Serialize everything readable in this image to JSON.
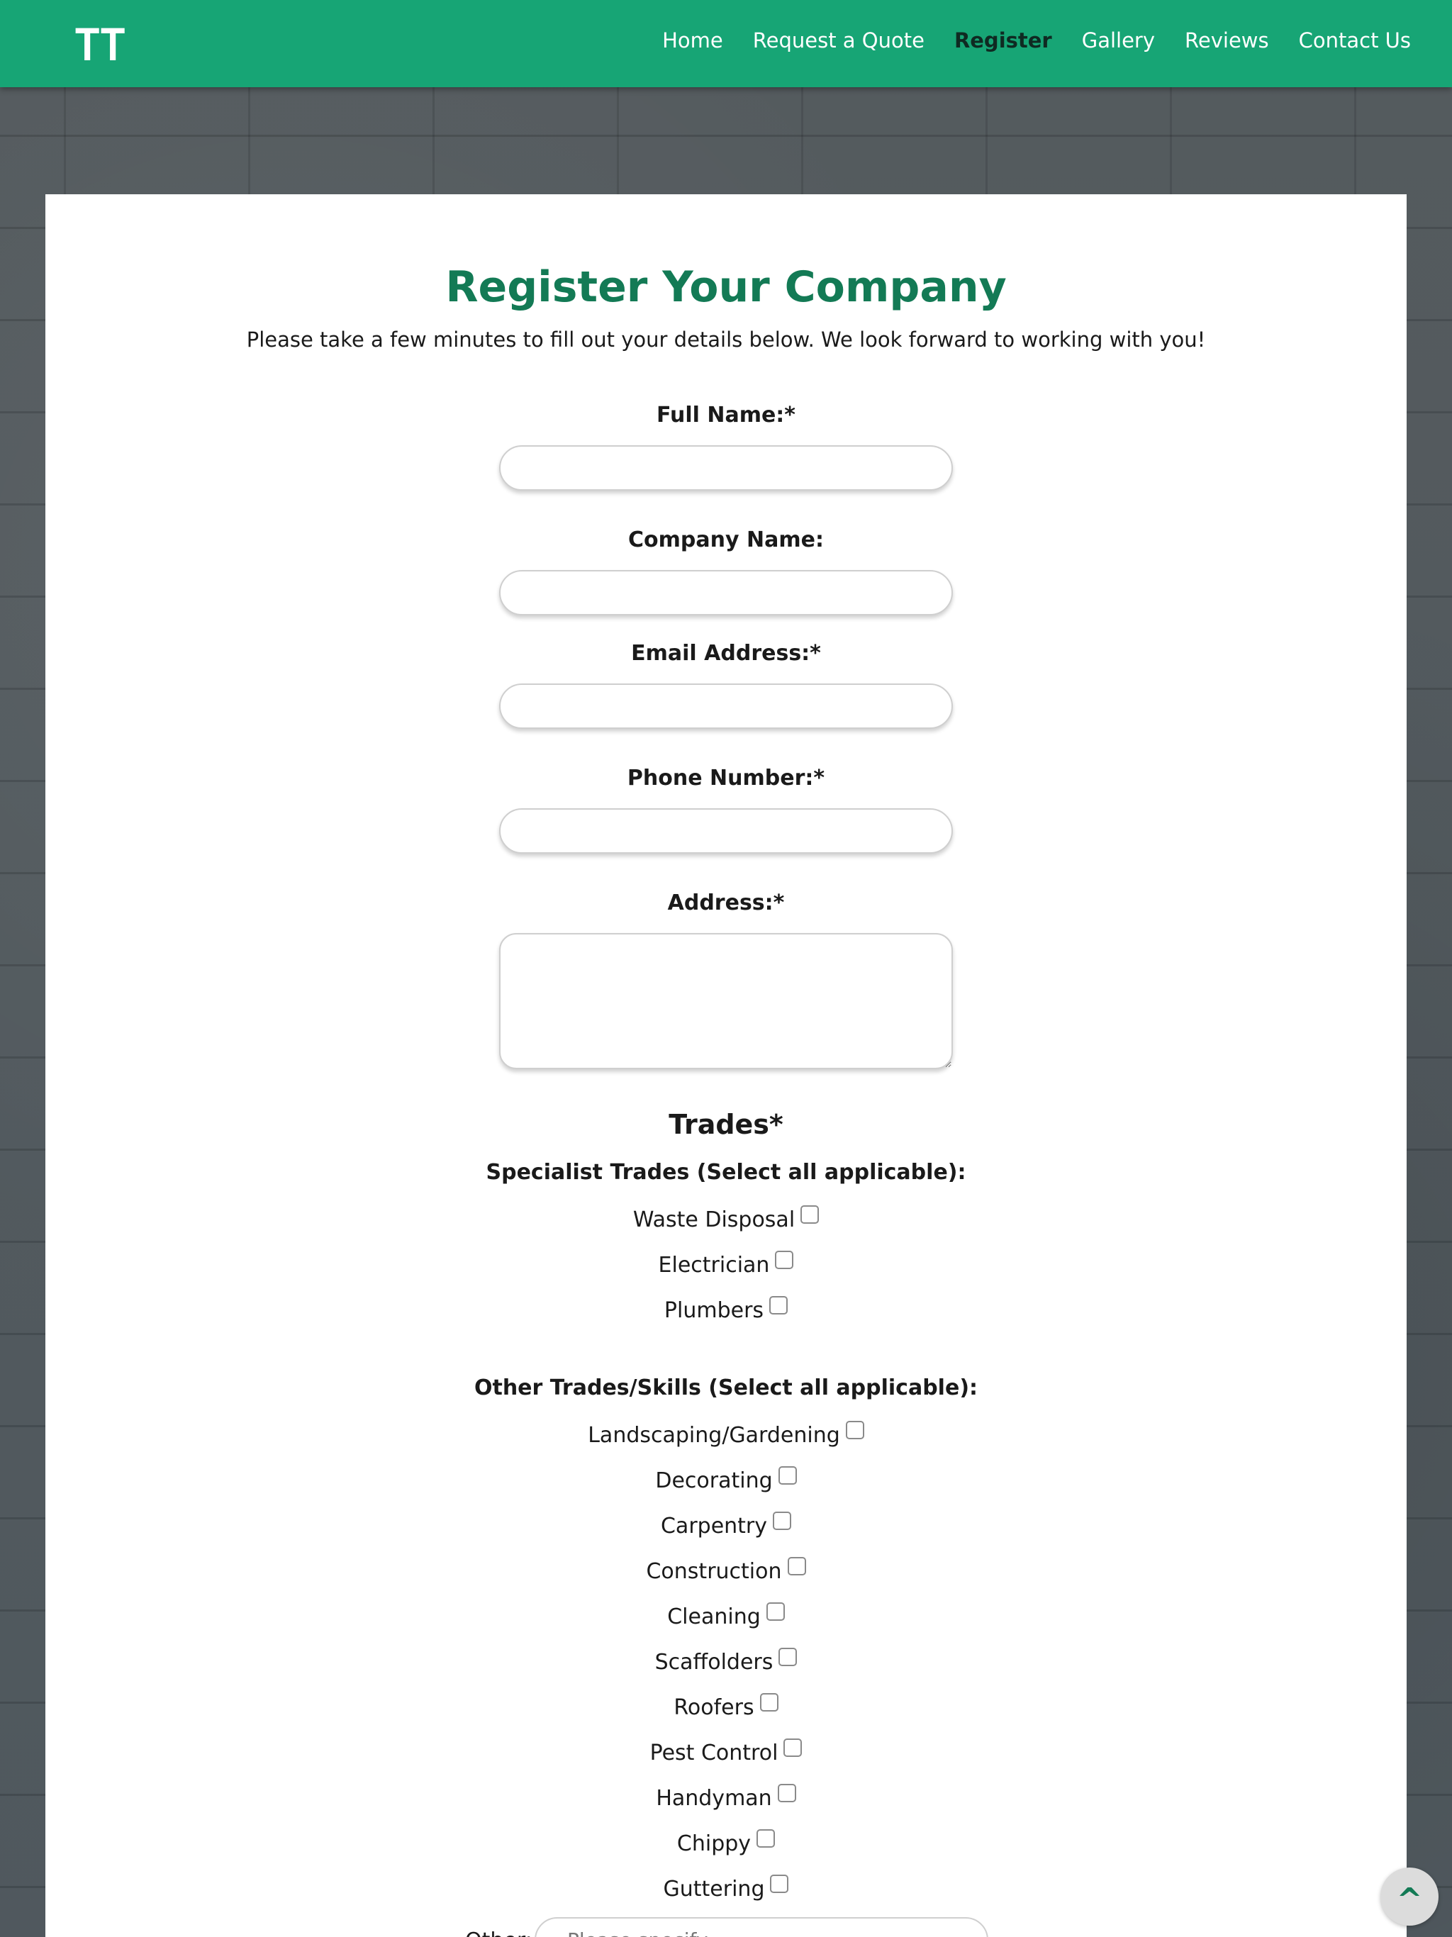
{
  "header": {
    "logo": "TT",
    "nav": [
      {
        "label": "Home"
      },
      {
        "label": "Request a Quote"
      },
      {
        "label": "Register",
        "active": true
      },
      {
        "label": "Gallery"
      },
      {
        "label": "Reviews"
      },
      {
        "label": "Contact Us"
      }
    ]
  },
  "form": {
    "title": "Register Your Company",
    "subtitle": "Please take a few minutes to fill out your details below. We look forward to working with you!",
    "fields": {
      "full_name": {
        "label": "Full Name:*",
        "value": ""
      },
      "company_name": {
        "label": "Company Name:",
        "value": ""
      },
      "email": {
        "label": "Email Address:*",
        "value": ""
      },
      "phone": {
        "label": "Phone Number:*",
        "value": ""
      },
      "address": {
        "label": "Address:*",
        "value": ""
      }
    },
    "trades_heading": "Trades*",
    "specialist": {
      "heading": "Specialist Trades (Select all applicable):",
      "options": [
        "Waste Disposal",
        "Electrician",
        "Plumbers"
      ]
    },
    "other": {
      "heading": "Other Trades/Skills (Select all applicable):",
      "options": [
        "Landscaping/Gardening",
        "Decorating",
        "Carpentry",
        "Construction",
        "Cleaning",
        "Scaffolders",
        "Roofers",
        "Pest Control",
        "Handyman",
        "Chippy",
        "Guttering"
      ],
      "other_label": "Other:",
      "other_placeholder": "Please specify"
    }
  },
  "scroll_top": {
    "glyph": "^"
  },
  "colors": {
    "header": "#17a575",
    "title": "#137a55",
    "active_nav": "#0f2a22"
  }
}
